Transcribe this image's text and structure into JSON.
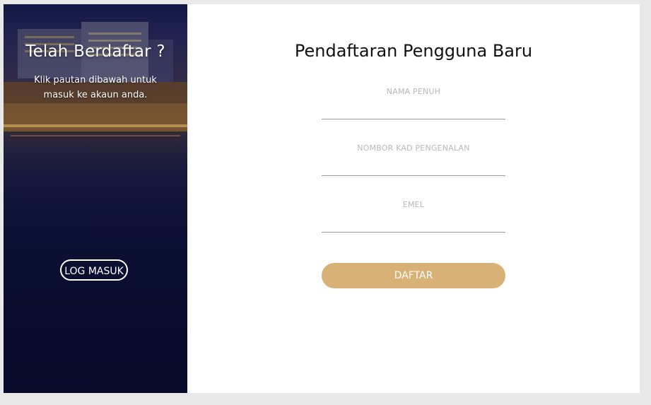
{
  "side_panel": {
    "heading": "Telah Berdaftar ?",
    "text": "Klik pautan dibawah untuk masuk ke akaun anda.",
    "login_label": "LOG MASUK"
  },
  "form": {
    "title": "Pendaftaran Pengguna Baru",
    "fields": [
      {
        "label": "NAMA PENUH",
        "value": ""
      },
      {
        "label": "NOMBOR KAD PENGENALAN",
        "value": ""
      },
      {
        "label": "EMEL",
        "value": ""
      }
    ],
    "submit_label": "DAFTAR"
  },
  "colors": {
    "accent": "#d8b177",
    "page_bg": "#e9e9e9",
    "panel_bg": "#0c1232"
  }
}
